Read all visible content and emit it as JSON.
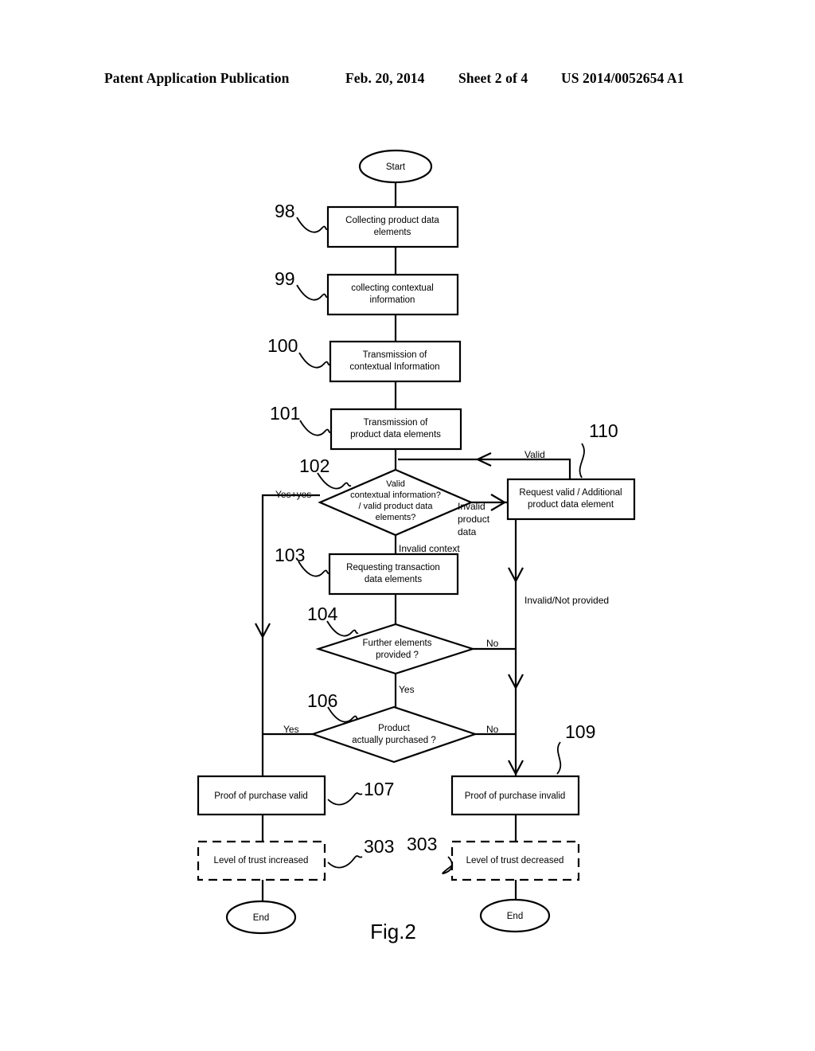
{
  "header": {
    "publication": "Patent Application Publication",
    "date": "Feb. 20, 2014",
    "sheet": "Sheet 2 of 4",
    "patent_number": "US 2014/0052654 A1"
  },
  "figure": {
    "caption": "Fig.2"
  },
  "flowchart": {
    "nodes": {
      "start": {
        "label": "Start",
        "shape": "ellipse"
      },
      "n98": {
        "ref": "98",
        "label_line1": "Collecting product data",
        "label_line2": "elements",
        "shape": "process"
      },
      "n99": {
        "ref": "99",
        "label_line1": "collecting contextual",
        "label_line2": "information",
        "shape": "process"
      },
      "n100": {
        "ref": "100",
        "label_line1": "Transmission of",
        "label_line2": "contextual Information",
        "shape": "process"
      },
      "n101": {
        "ref": "101",
        "label_line1": "Transmission of",
        "label_line2": "product data elements",
        "shape": "process"
      },
      "n102": {
        "ref": "102",
        "label_line1": "Valid",
        "label_line2": "contextual information?",
        "label_line3": "/ valid product data",
        "label_line4": "elements?",
        "shape": "decision"
      },
      "n110": {
        "ref": "110",
        "label_line1": "Request valid / Additional",
        "label_line2": "product data element",
        "shape": "process"
      },
      "n103": {
        "ref": "103",
        "label_line1": "Requesting transaction",
        "label_line2": "data elements",
        "shape": "process"
      },
      "n104": {
        "ref": "104",
        "label_line1": "Further elements",
        "label_line2": "provided ?",
        "shape": "decision"
      },
      "n106": {
        "ref": "106",
        "label_line1": "Product",
        "label_line2": "actually purchased ?",
        "shape": "decision"
      },
      "n107": {
        "ref": "107",
        "label_line1": "Proof of purchase valid",
        "shape": "process"
      },
      "n109": {
        "ref": "109",
        "label_line1": "Proof of purchase invalid",
        "shape": "process"
      },
      "n303_left": {
        "ref": "303",
        "label_line1": "Level of trust increased",
        "shape": "process-dashed"
      },
      "n303_right": {
        "ref": "303",
        "label_line1": "Level of trust decreased",
        "shape": "process-dashed"
      },
      "end_left": {
        "label": "End",
        "shape": "ellipse"
      },
      "end_right": {
        "label": "End",
        "shape": "ellipse"
      }
    },
    "edge_labels": {
      "valid": "Valid",
      "yes_plus_yes": "Yes+yes",
      "invalid_product_data_l1": "Invalid",
      "invalid_product_data_l2": "product",
      "invalid_product_data_l3": "data",
      "invalid_context": "Invalid context",
      "invalid_not_provided": "Invalid/Not provided",
      "no_104": "No",
      "yes_104": "Yes",
      "yes_106": "Yes",
      "no_106": "No"
    }
  }
}
